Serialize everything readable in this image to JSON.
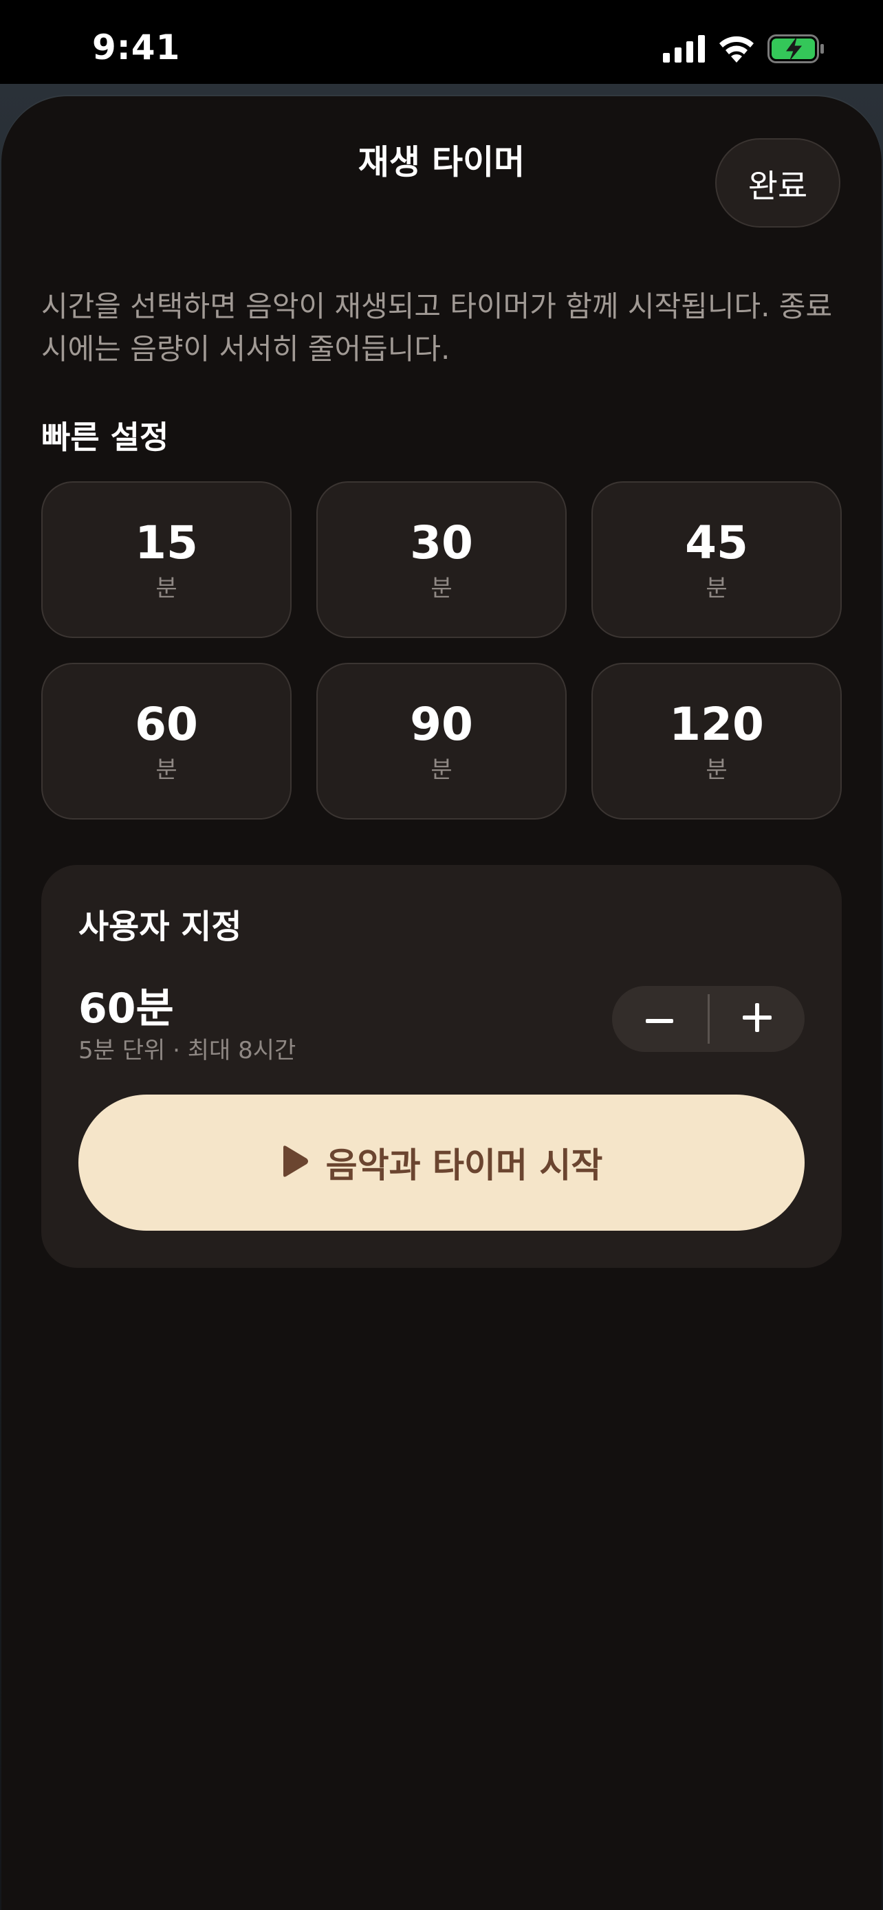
{
  "status_bar": {
    "time": "9:41"
  },
  "sheet": {
    "title": "재생 타이머",
    "done_label": "완료",
    "description": "시간을 선택하면 음악이 재생되고 타이머가 함께 시작됩니다. 종료 시에는 음량이 서서히 줄어듭니다."
  },
  "quick": {
    "title": "빠른 설정",
    "presets": [
      {
        "value": "15",
        "unit": "분"
      },
      {
        "value": "30",
        "unit": "분"
      },
      {
        "value": "45",
        "unit": "분"
      },
      {
        "value": "60",
        "unit": "분"
      },
      {
        "value": "90",
        "unit": "분"
      },
      {
        "value": "120",
        "unit": "분"
      }
    ]
  },
  "custom": {
    "title": "사용자 지정",
    "value": "60분",
    "hint": "5분 단위 · 최대 8시간",
    "start_label": "음악과 타이머 시작"
  },
  "colors": {
    "sheet_background": "#13100f",
    "card_background": "#231e1c",
    "start_button": "#f5e5c9",
    "start_text": "#6b4530",
    "battery_fill": "#34c759"
  },
  "icons": {
    "signal": "signal-icon",
    "wifi": "wifi-icon",
    "battery": "battery-charging-icon",
    "minus": "minus-icon",
    "plus": "plus-icon",
    "play": "play-icon"
  }
}
